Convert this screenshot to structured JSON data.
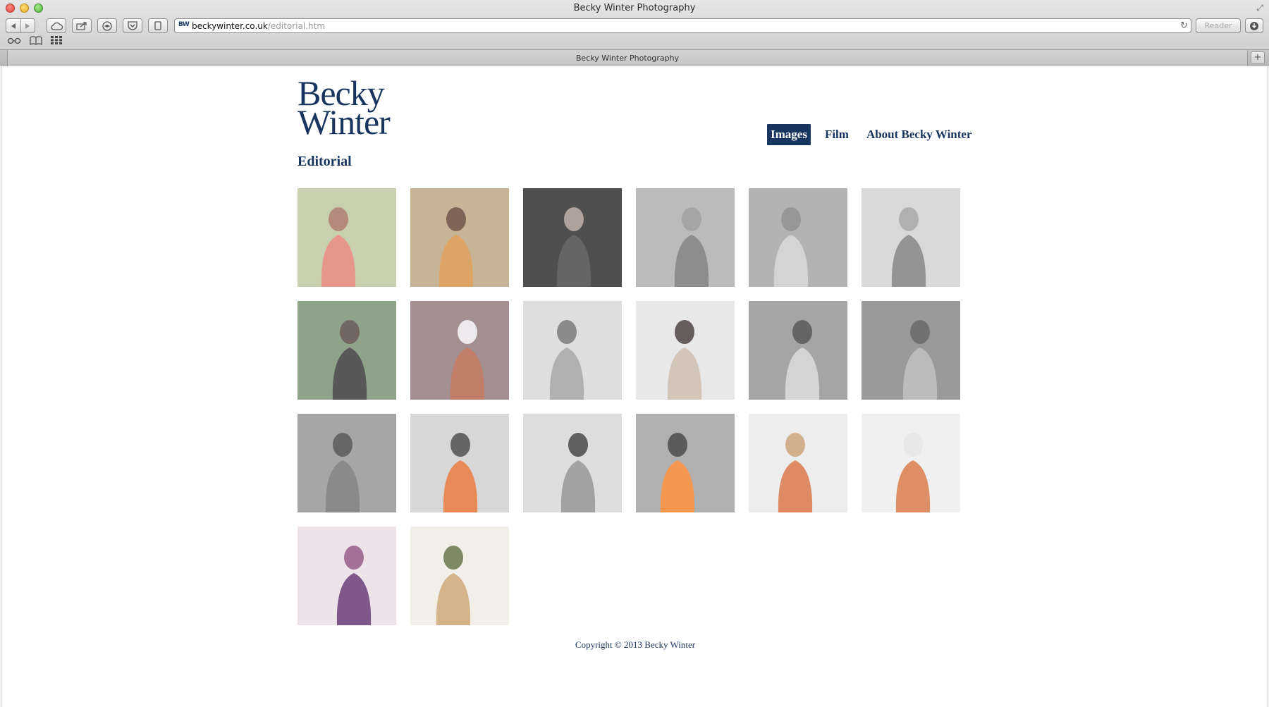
{
  "browser": {
    "window_title": "Becky Winter Photography",
    "tab_title": "Becky Winter Photography",
    "address": {
      "favicon": "BW",
      "domain": "beckywinter.co.uk",
      "path": "/editorial.htm"
    },
    "reader_label": "Reader",
    "new_tab_label": "+",
    "icons": [
      "back-icon",
      "forward-icon",
      "cloud-icon",
      "share-icon",
      "layers-icon",
      "pocket-icon",
      "tab-view-icon",
      "reload-icon",
      "download-icon",
      "reading-list-icon",
      "bookmarks-icon",
      "top-sites-icon"
    ]
  },
  "site": {
    "logo_line1": "Becky",
    "logo_line2": "Winter",
    "nav": [
      {
        "label": "Images",
        "active": true
      },
      {
        "label": "Film",
        "active": false
      },
      {
        "label": "About Becky Winter",
        "active": false
      }
    ],
    "section_title": "Editorial",
    "footer": "Copyright © 2013   Becky Winter",
    "brand_color": "#17355e"
  },
  "gallery": {
    "thumbnails": [
      {
        "bg": "#b9c49a",
        "figure": "#a06a5c",
        "accent": "#e07b6a"
      },
      {
        "bg": "#b8a07a",
        "figure": "#5a3a2a",
        "accent": "#d38b3a"
      },
      {
        "bg": "#1e1e1e",
        "figure": "#9a8a80",
        "accent": "#3a3a3a"
      },
      {
        "bg": "#a9a9a9",
        "figure": "#8c8c8c",
        "accent": "#6e6e6e"
      },
      {
        "bg": "#9e9e9e",
        "figure": "#7a7a7a",
        "accent": "#c8c8c8"
      },
      {
        "bg": "#cfcfcf",
        "figure": "#9a9a9a",
        "accent": "#777777"
      },
      {
        "bg": "#6f8a6a",
        "figure": "#4a3c38",
        "accent": "#2a2a2a"
      },
      {
        "bg": "#8a6f72",
        "figure": "#e8e4e8",
        "accent": "#b05a40"
      },
      {
        "bg": "#d6d6d6",
        "figure": "#6a6a6a",
        "accent": "#9a9a9a"
      },
      {
        "bg": "#e2e2e2",
        "figure": "#3a3030",
        "accent": "#c9b6a6"
      },
      {
        "bg": "#8c8c8c",
        "figure": "#3a3a3a",
        "accent": "#c9c9c9"
      },
      {
        "bg": "#7e7e7e",
        "figure": "#4a4a4a",
        "accent": "#aaaaaa"
      },
      {
        "bg": "#8e8e8e",
        "figure": "#3c3c3c",
        "accent": "#6a6a6a"
      },
      {
        "bg": "#cdcdcd",
        "figure": "#3a3a3a",
        "accent": "#e26a2a"
      },
      {
        "bg": "#d4d4d4",
        "figure": "#333333",
        "accent": "#888888"
      },
      {
        "bg": "#9b9b9b",
        "figure": "#2e2e2e",
        "accent": "#f27a20"
      },
      {
        "bg": "#e9e9e9",
        "figure": "#c79a6e",
        "accent": "#d46a3a"
      },
      {
        "bg": "#ededed",
        "figure": "#e2e2e2",
        "accent": "#d5703a"
      },
      {
        "bg": "#e8dce2",
        "figure": "#8a4a7a",
        "accent": "#5a2a6a"
      },
      {
        "bg": "#efeae2",
        "figure": "#5a6a3a",
        "accent": "#caa06a"
      }
    ]
  }
}
